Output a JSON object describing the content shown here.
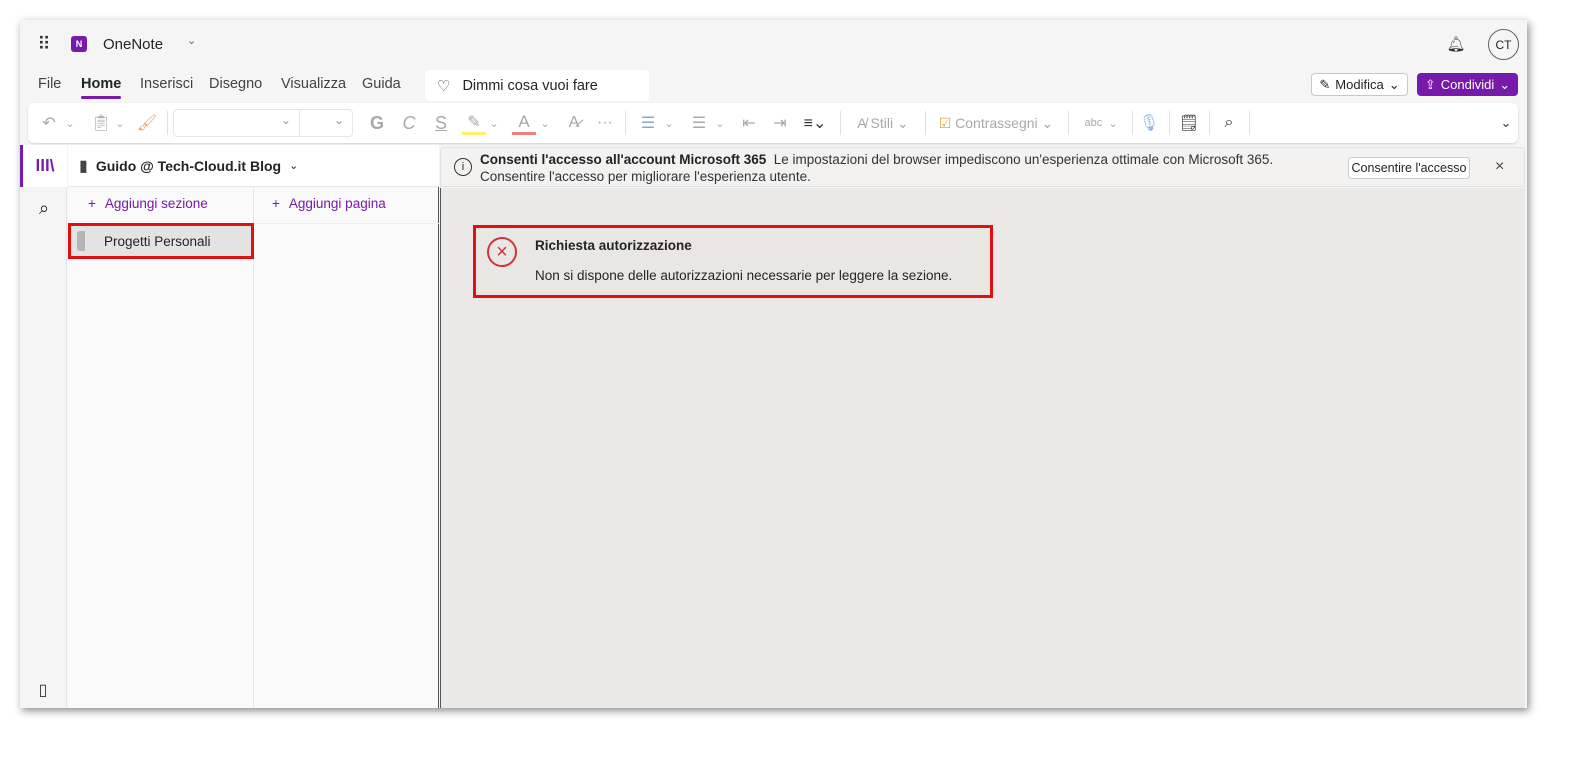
{
  "app": {
    "name": "OneNote",
    "avatar": "CT"
  },
  "tabs": [
    "File",
    "Home",
    "Inserisci",
    "Disegno",
    "Visualizza",
    "Guida"
  ],
  "search": {
    "placeholder": "Dimmi cosa vuoi fare"
  },
  "actions": {
    "edit": "Modifica",
    "share": "Condividi"
  },
  "toolbar": {
    "bold": "G",
    "italic": "C",
    "underline": "S",
    "styles": "Stili",
    "tags": "Contrassegni",
    "more": "···",
    "spell": "abc"
  },
  "notebook": {
    "name": "Guido @ Tech-Cloud.it Blog",
    "add_section": "Aggiungi sezione",
    "add_page": "Aggiungi pagina",
    "sections": [
      "Progetti Personali"
    ]
  },
  "infobar": {
    "title": "Consenti l'accesso all'account Microsoft 365",
    "message": "Le impostazioni del browser impediscono un'esperienza ottimale con Microsoft 365. Consentire l'accesso per migliorare l'esperienza utente.",
    "button": "Consentire l'accesso",
    "close": "×"
  },
  "error": {
    "title": "Richiesta autorizzazione",
    "message": "Non si dispone delle autorizzazioni necessarie per leggere la sezione."
  },
  "colors": {
    "accent": "#7719aa",
    "highlight": "#e00000"
  }
}
